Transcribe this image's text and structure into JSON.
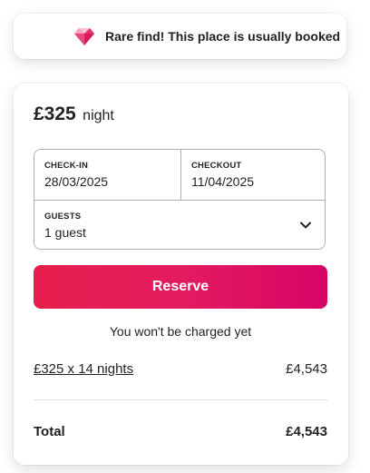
{
  "rare_banner": {
    "icon": "diamond-icon",
    "text": "Rare find! This place is usually booked"
  },
  "booking": {
    "price": "£325",
    "price_unit": "night",
    "checkin": {
      "label": "CHECK-IN",
      "value": "28/03/2025"
    },
    "checkout": {
      "label": "CHECKOUT",
      "value": "11/04/2025"
    },
    "guests": {
      "label": "GUESTS",
      "value": "1 guest",
      "icon": "chevron-down-icon"
    },
    "reserve_label": "Reserve",
    "no_charge_note": "You won't be charged yet",
    "breakdown": {
      "nights_label": "£325 x 14 nights",
      "nights_amount": "£4,543"
    },
    "total": {
      "label": "Total",
      "amount": "£4,543"
    }
  },
  "colors": {
    "accent_start": "#e61e4d",
    "accent_end": "#d70466",
    "gem_pink": "#e8326b",
    "text": "#222222",
    "border": "#b0b0b0"
  }
}
